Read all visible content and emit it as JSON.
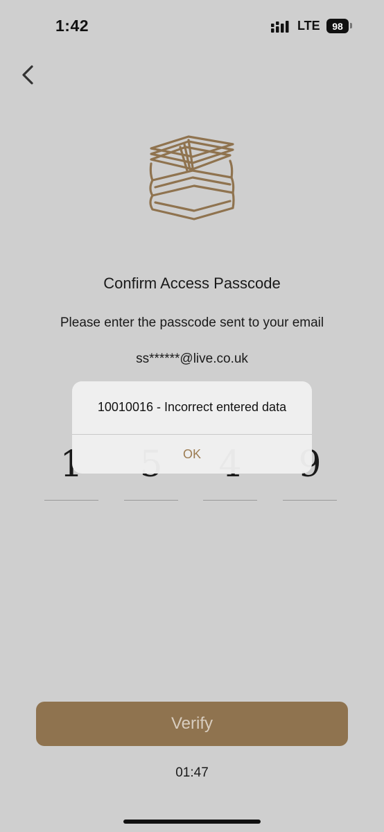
{
  "status_bar": {
    "time": "1:42",
    "network": "LTE",
    "battery": "98"
  },
  "icons": {
    "back": "chevron-left-icon",
    "logo": "book-stack-logo",
    "signal": "signal-icon"
  },
  "colors": {
    "background": "#cfcfcf",
    "accent": "#8f734f",
    "alert_action": "#9c7c52"
  },
  "screen": {
    "title": "Confirm Access Passcode",
    "instruction": "Please enter the passcode sent to your email",
    "email": "ss******@live.co.uk",
    "code_digits": [
      "1",
      "5",
      "4",
      "9"
    ]
  },
  "alert": {
    "message": "10010016 - Incorrect entered data",
    "ok_label": "OK"
  },
  "footer": {
    "verify_label": "Verify",
    "countdown": "01:47"
  }
}
